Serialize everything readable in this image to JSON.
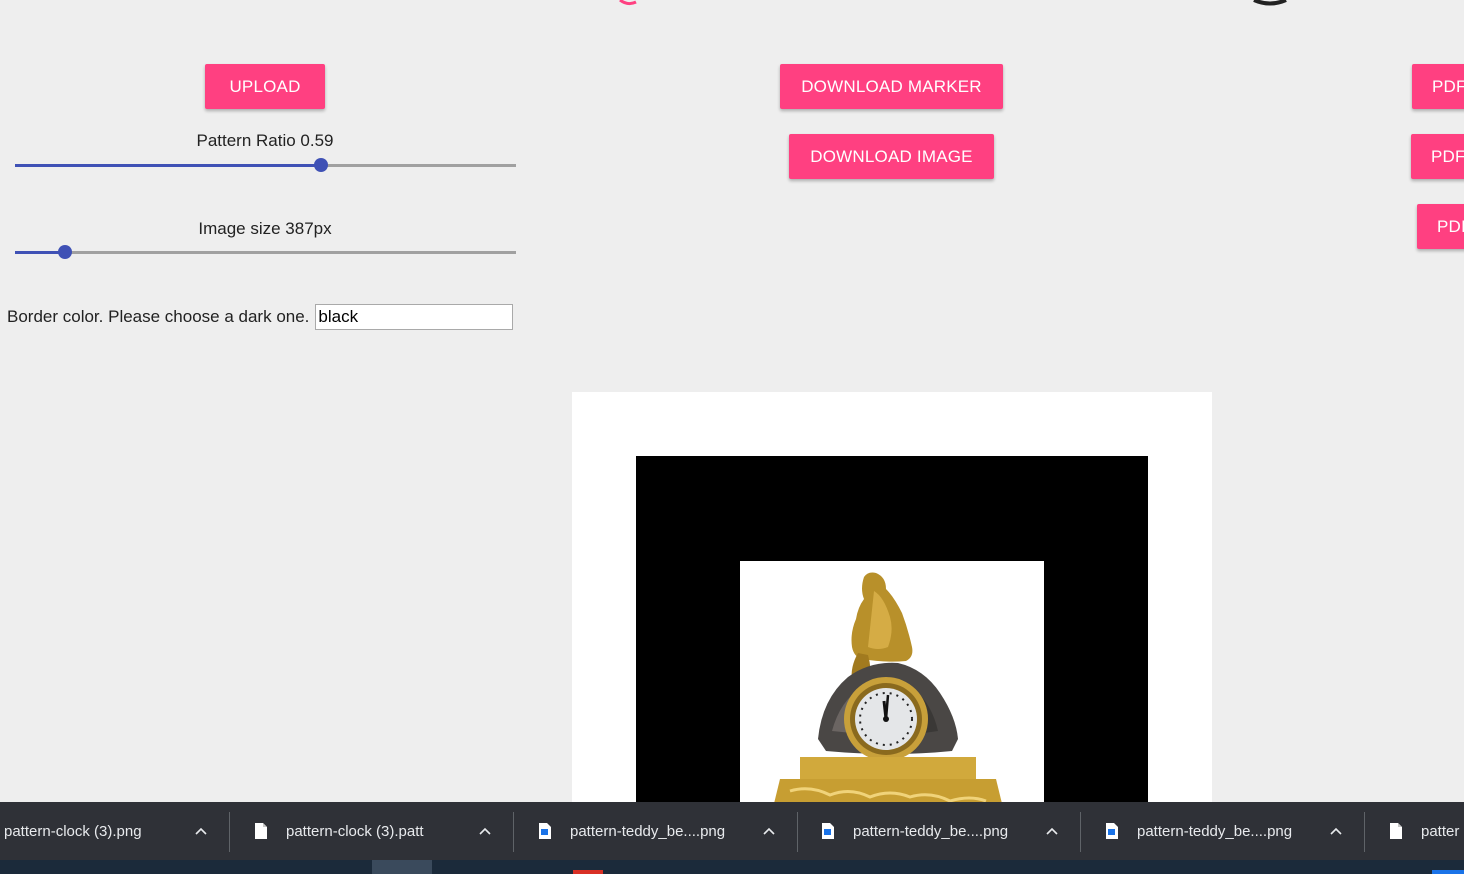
{
  "toolbar": {
    "upload_label": "UPLOAD",
    "download_marker_label": "DOWNLOAD MARKER",
    "download_image_label": "DOWNLOAD IMAGE",
    "pdf_label_1": "PDF",
    "pdf_label_2": "PDF",
    "pdf_label_3": "PDI"
  },
  "controls": {
    "pattern_ratio_label": "Pattern Ratio 0.59",
    "pattern_ratio_level": 0.61,
    "image_size_label": "Image size 387px",
    "image_size_level": 0.1,
    "border_color_label": "Border color. Please choose a dark one.",
    "border_color_value": "black"
  },
  "colors": {
    "accent": "#ff4081",
    "slider": "#3f51b5",
    "background": "#eeeeee",
    "downloads_bar": "#2f3137"
  },
  "downloads": {
    "items": [
      {
        "name": "pattern-clock (3).png",
        "icon": "image-file-icon"
      },
      {
        "name": "pattern-clock (3).patt",
        "icon": "file-icon"
      },
      {
        "name": "pattern-teddy_be....png",
        "icon": "image-file-icon"
      },
      {
        "name": "pattern-teddy_be....png",
        "icon": "image-file-icon"
      },
      {
        "name": "pattern-teddy_be....png",
        "icon": "image-file-icon"
      },
      {
        "name": "patter",
        "icon": "file-icon"
      }
    ]
  }
}
